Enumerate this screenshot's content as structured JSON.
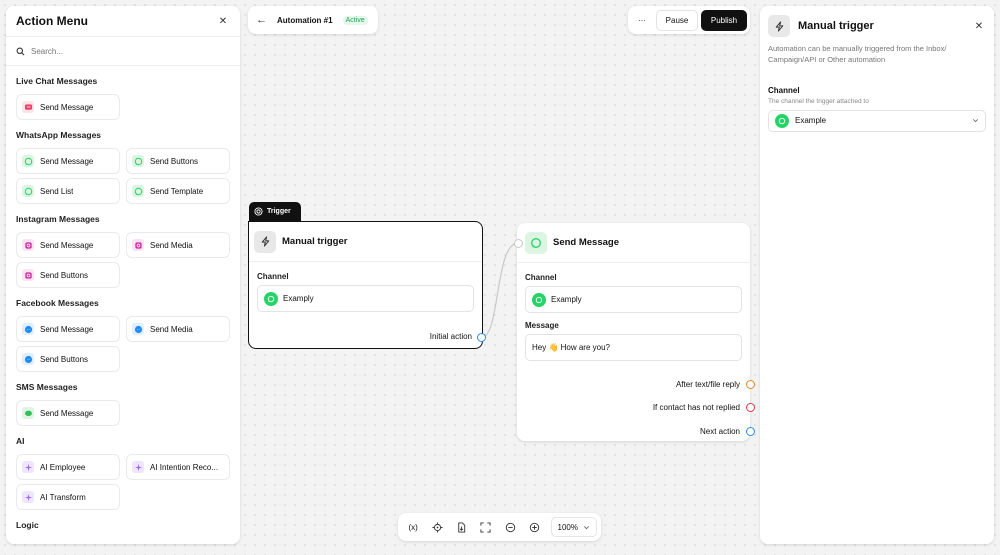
{
  "action_menu": {
    "title": "Action Menu",
    "search_placeholder": "Search...",
    "groups": [
      {
        "title": "Live Chat Messages",
        "items": [
          {
            "label": "Send Message",
            "icon": "chat-bubble-icon"
          }
        ]
      },
      {
        "title": "WhatsApp Messages",
        "items": [
          {
            "label": "Send Message",
            "icon": "whatsapp-icon"
          },
          {
            "label": "Send Buttons",
            "icon": "whatsapp-icon"
          },
          {
            "label": "Send List",
            "icon": "whatsapp-icon"
          },
          {
            "label": "Send Template",
            "icon": "whatsapp-icon"
          }
        ]
      },
      {
        "title": "Instagram Messages",
        "items": [
          {
            "label": "Send Message",
            "icon": "instagram-icon"
          },
          {
            "label": "Send Media",
            "icon": "instagram-icon"
          },
          {
            "label": "Send Buttons",
            "icon": "instagram-icon"
          }
        ]
      },
      {
        "title": "Facebook Messages",
        "items": [
          {
            "label": "Send Message",
            "icon": "messenger-icon"
          },
          {
            "label": "Send Media",
            "icon": "messenger-icon"
          },
          {
            "label": "Send Buttons",
            "icon": "messenger-icon"
          }
        ]
      },
      {
        "title": "SMS Messages",
        "items": [
          {
            "label": "Send Message",
            "icon": "sms-icon"
          }
        ]
      },
      {
        "title": "AI",
        "items": [
          {
            "label": "AI Employee",
            "icon": "sparkle-icon"
          },
          {
            "label": "AI Intention Reco...",
            "icon": "sparkle-icon"
          },
          {
            "label": "AI Transform",
            "icon": "sparkle-icon"
          }
        ]
      },
      {
        "title": "Logic",
        "items": []
      }
    ]
  },
  "topbar": {
    "automation_name": "Automation #1",
    "status": "Active",
    "more_label": "···",
    "pause_label": "Pause",
    "publish_label": "Publish"
  },
  "trigger_node": {
    "tab_label": "Trigger",
    "title": "Manual trigger",
    "channel_label": "Channel",
    "channel_value": "Examply",
    "output_label": "Initial action"
  },
  "send_node": {
    "title": "Send Message",
    "channel_label": "Channel",
    "channel_value": "Examply",
    "message_label": "Message",
    "message_value": "Hey 👋 How are you?",
    "outputs": [
      {
        "label": "After text/file reply",
        "color": "#e8862b"
      },
      {
        "label": "If contact has not replied",
        "color": "#e03a4a"
      },
      {
        "label": "Next action",
        "color": "#2b8ce0"
      }
    ]
  },
  "bottom_toolbar": {
    "zoom": "100%"
  },
  "right_panel": {
    "title": "Manual trigger",
    "description": "Automation can be manually triggered from the Inbox/ Campaign/API or Other automation",
    "channel_label": "Channel",
    "channel_help": "The channel the trigger attached to",
    "channel_value": "Example"
  },
  "colors": {
    "whatsapp": "#25d366",
    "primary": "#111111",
    "active_badge": "#23a455",
    "connector": "#2b8ce0"
  }
}
